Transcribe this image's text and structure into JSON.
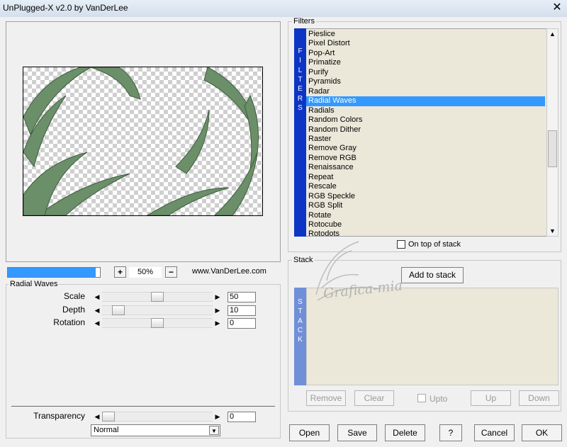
{
  "window": {
    "title": "UnPlugged-X v2.0 by VanDerLee",
    "close_glyph": "✕"
  },
  "zoom": {
    "progress_fraction": 0.95,
    "plus": "+",
    "value": "50%",
    "minus": "−",
    "website": "www.VanDerLee.com"
  },
  "params": {
    "group_title": "Radial Waves",
    "left_arrow": "◀",
    "right_arrow": "▶",
    "rows": [
      {
        "label": "Scale",
        "value": "50",
        "fraction": 0.5
      },
      {
        "label": "Depth",
        "value": "10",
        "fraction": 0.1
      },
      {
        "label": "Rotation",
        "value": "0",
        "fraction": 0.5
      }
    ],
    "transparency": {
      "label": "Transparency",
      "value": "0",
      "fraction": 0.0
    },
    "blend_mode": "Normal",
    "dropdown_glyph": "▼"
  },
  "filters": {
    "group_title": "Filters",
    "sidebar_letters": [
      "F",
      "I",
      "L",
      "T",
      "E",
      "R",
      "S"
    ],
    "items": [
      "Pieslice",
      "Pixel Distort",
      "Pop-Art",
      "Primatize",
      "Purify",
      "Pyramids",
      "Radar",
      "Radial Waves",
      "Radials",
      "Random Colors",
      "Random Dither",
      "Raster",
      "Remove Gray",
      "Remove RGB",
      "Renaissance",
      "Repeat",
      "Rescale",
      "RGB Speckle",
      "RGB Split",
      "Rotate",
      "Rotocube",
      "Rotodots"
    ],
    "selected": "Radial Waves",
    "scroll_up": "▲",
    "scroll_down": "▼",
    "on_top_label": "On top of stack"
  },
  "stack": {
    "group_title": "Stack",
    "add_button": "Add to stack",
    "sidebar_letters": [
      "S",
      "T",
      "A",
      "C",
      "K"
    ],
    "remove": "Remove",
    "clear": "Clear",
    "upto": "Upto",
    "up": "Up",
    "down": "Down"
  },
  "watermark": {
    "text": "Grafica-mia"
  },
  "buttons": {
    "open": "Open",
    "save": "Save",
    "delete": "Delete",
    "help": "?",
    "cancel": "Cancel",
    "ok": "OK"
  },
  "colors": {
    "selection": "#3399ff",
    "filters_bar": "#0c35c5",
    "stack_bar": "#6f8fd8",
    "list_bg": "#ebe8da",
    "leaf": "#6b8f68"
  }
}
